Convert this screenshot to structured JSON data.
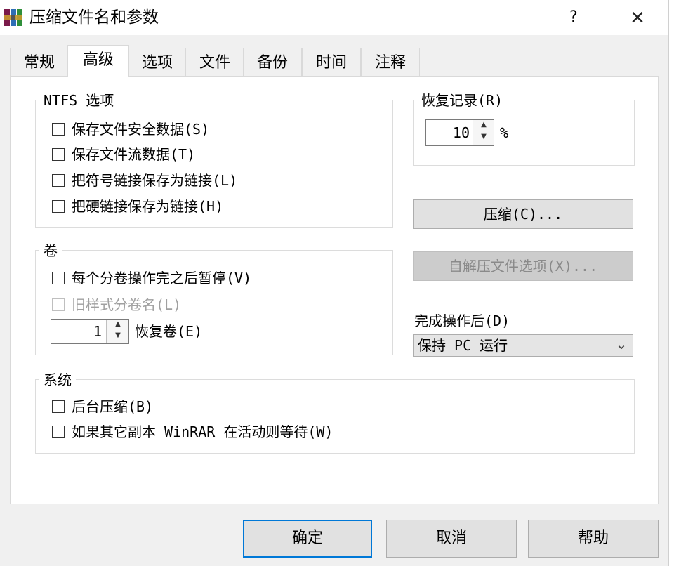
{
  "window": {
    "title": "压缩文件名和参数",
    "help_button": "?",
    "close_button": "✕"
  },
  "tabs": [
    {
      "label": "常规",
      "active": false
    },
    {
      "label": "高级",
      "active": true
    },
    {
      "label": "选项",
      "active": false
    },
    {
      "label": "文件",
      "active": false
    },
    {
      "label": "备份",
      "active": false
    },
    {
      "label": "时间",
      "active": false
    },
    {
      "label": "注释",
      "active": false
    }
  ],
  "ntfs": {
    "legend": "NTFS 选项",
    "options": [
      {
        "label": "保存文件安全数据(S)",
        "checked": false
      },
      {
        "label": "保存文件流数据(T)",
        "checked": false
      },
      {
        "label": "把符号链接保存为链接(L)",
        "checked": false
      },
      {
        "label": "把硬链接保存为链接(H)",
        "checked": false
      }
    ]
  },
  "recovery": {
    "legend": "恢复记录(R)",
    "value": "10",
    "unit": "%"
  },
  "buttons": {
    "compress": "压缩(C)...",
    "sfx_options": "自解压文件选项(X)...",
    "ok": "确定",
    "cancel": "取消",
    "help": "帮助"
  },
  "volumes": {
    "legend": "卷",
    "pause_label": "每个分卷操作完之后暂停(V)",
    "pause_checked": false,
    "old_style_label": "旧样式分卷名(L)",
    "old_style_checked": false,
    "recovery_volumes_value": "1",
    "recovery_volumes_label": "恢复卷(E)"
  },
  "after_completion": {
    "label": "完成操作后(D)",
    "selected": "保持 PC 运行"
  },
  "system": {
    "legend": "系统",
    "options": [
      {
        "label": "后台压缩(B)",
        "checked": false
      },
      {
        "label": "如果其它副本 WinRAR 在活动则等待(W)",
        "checked": false
      }
    ]
  },
  "icons": {
    "app": "winrar-icon",
    "spin_up": "▲",
    "spin_down": "▼",
    "dropdown": "⌄"
  },
  "colors": {
    "accent": "#0078d7",
    "panel": "#ffffff",
    "dialog_bg": "#f0f0f0"
  }
}
